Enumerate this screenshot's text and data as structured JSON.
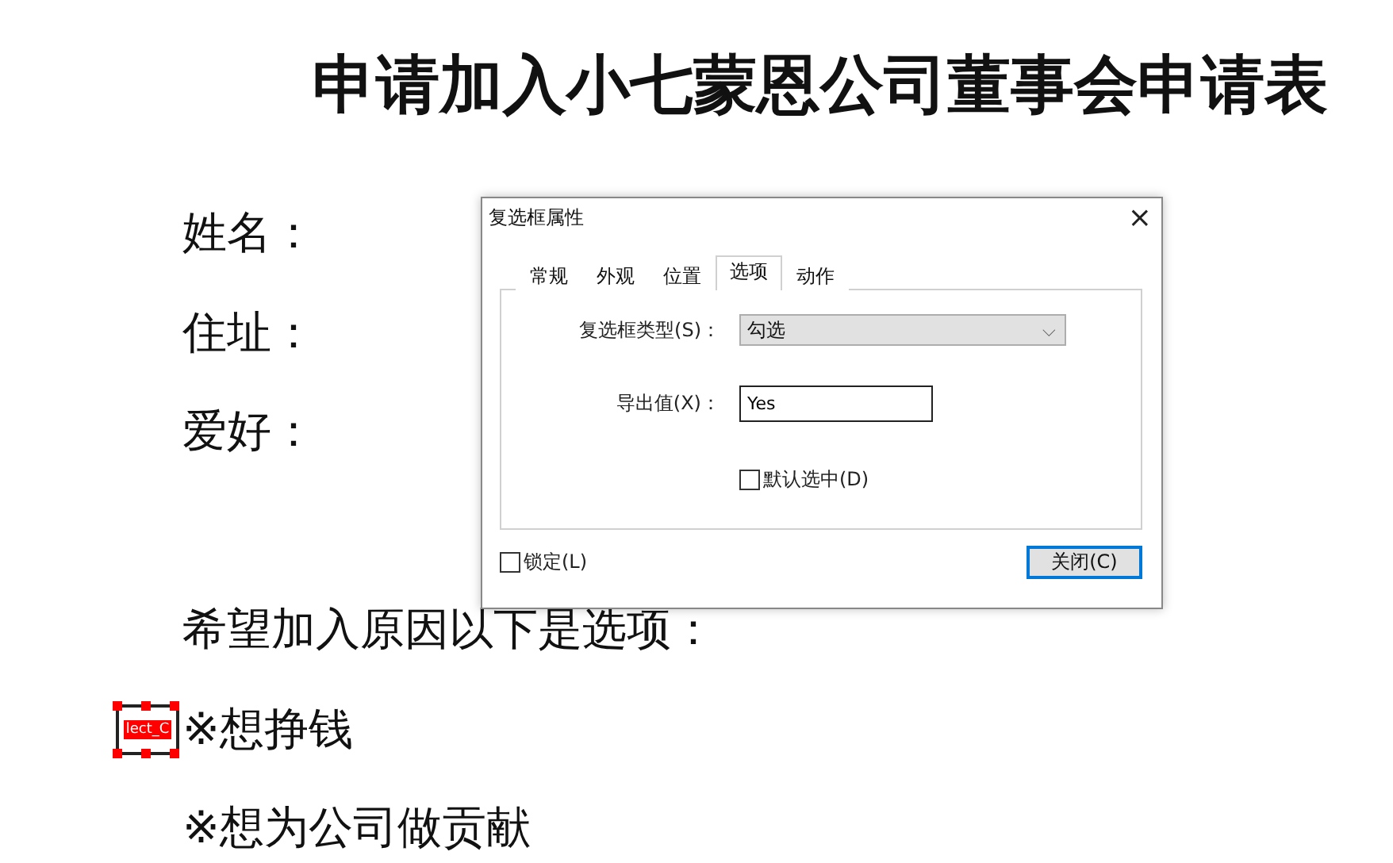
{
  "document": {
    "title": "申请加入小七蒙恩公司董事会申请表",
    "lines": [
      {
        "kind": "label",
        "text": "姓名："
      },
      {
        "kind": "label",
        "text": "住址："
      },
      {
        "kind": "label",
        "text": "爱好："
      },
      {
        "kind": "gap"
      },
      {
        "kind": "label",
        "text": "希望加入原因以下是选项："
      },
      {
        "kind": "option",
        "text": "※想挣钱",
        "field": {
          "text": "lect_C",
          "selected": true
        }
      },
      {
        "kind": "option",
        "text": "※想为公司做贡献"
      }
    ]
  },
  "dialog": {
    "title": "复选框属性",
    "close": "×",
    "tabs": [
      {
        "label": "常规",
        "selected": false
      },
      {
        "label": "外观",
        "selected": false
      },
      {
        "label": "位置",
        "selected": false
      },
      {
        "label": "选项",
        "selected": true
      },
      {
        "label": "动作",
        "selected": false
      }
    ],
    "type_field": {
      "label": "复选框类型(S)：",
      "value": "勾选",
      "caret": "⌵"
    },
    "export_field": {
      "label": "导出值(X)：",
      "value": "Yes"
    },
    "default_checked": {
      "label": "默认选中(D)",
      "checked": false
    },
    "locked": {
      "label": "锁定(L)",
      "checked": false
    },
    "close_button": "关闭(C)"
  }
}
